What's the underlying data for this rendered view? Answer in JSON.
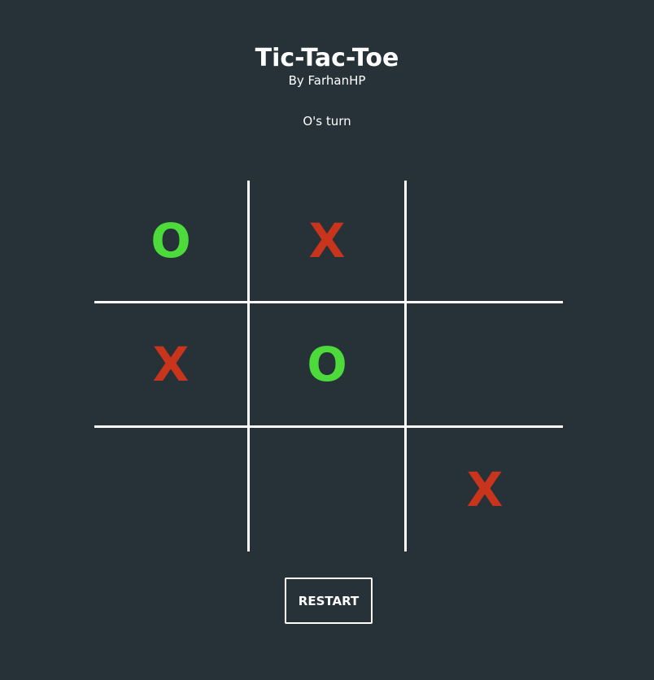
{
  "header": {
    "title": "Tic-Tac-Toe",
    "author": "By FarhanHP"
  },
  "status": "O's turn",
  "board": {
    "cells": [
      "O",
      "X",
      "",
      "X",
      "O",
      "",
      "",
      "",
      "X"
    ],
    "colors": {
      "X": "#c8341c",
      "O": "#4ddb3c",
      "grid": "#ffffff",
      "background": "#263238"
    }
  },
  "controls": {
    "restart_label": "RESTART"
  }
}
